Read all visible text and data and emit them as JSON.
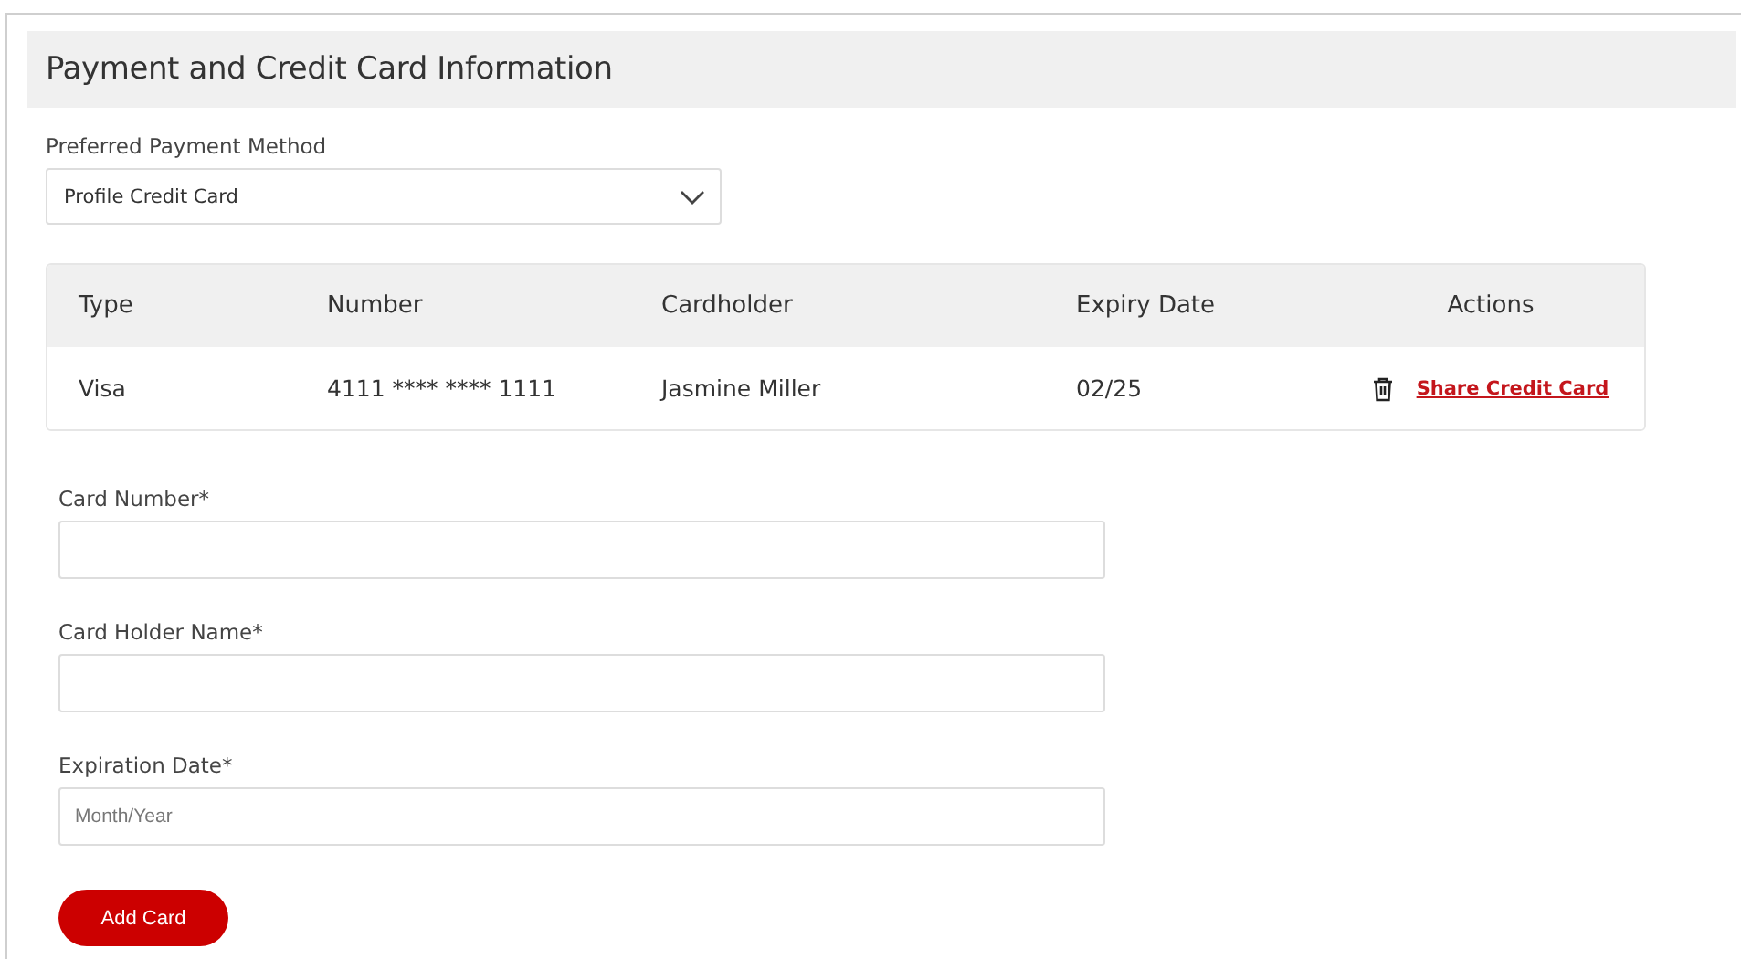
{
  "section": {
    "title": "Payment and Credit Card Information"
  },
  "payment_method": {
    "label": "Preferred Payment Method",
    "value": "Profile Credit Card"
  },
  "cards_table": {
    "columns": [
      "Type",
      "Number",
      "Cardholder",
      "Expiry Date",
      "Actions"
    ],
    "rows": [
      {
        "type": "Visa",
        "number": "4111 **** **** 1111",
        "cardholder": "Jasmine Miller",
        "expiry": "02/25",
        "action_link": "Share Credit Card"
      }
    ]
  },
  "form": {
    "fields": [
      {
        "label": "Card Number*"
      },
      {
        "label": "Card Holder Name*"
      },
      {
        "label": "Expiration Date*",
        "placeholder": "Month/Year"
      }
    ],
    "submit": "Add Card"
  }
}
